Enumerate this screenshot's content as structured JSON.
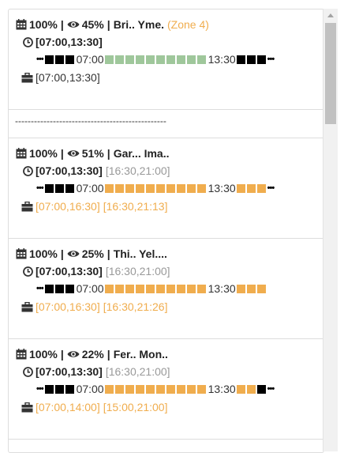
{
  "cards": [
    {
      "pct1": "100%",
      "pct2": "45%",
      "name": "Bri.. Yme.",
      "zone": "(Zone 4)",
      "hours_bold": "[07:00,13:30]",
      "hours_extra": "",
      "start_time": "07:00",
      "end_time": "13:30",
      "timeline_color": "green",
      "bar_count": 10,
      "after_blocks": [
        "black",
        "black",
        "black"
      ],
      "work_1": "[07:00,13:30]",
      "work_2": "",
      "work_color": "default"
    },
    {
      "pct1": "100%",
      "pct2": "51%",
      "name": "Gar... Ima..",
      "zone": "",
      "hours_bold": "[07:00,13:30]",
      "hours_extra": "[16:30,21:00]",
      "start_time": "07:00",
      "end_time": "13:30",
      "timeline_color": "orange",
      "bar_count": 10,
      "after_blocks": [
        "orange",
        "orange",
        "orange"
      ],
      "work_1": "[07:00,16:30]",
      "work_2": "[16:30,21:13]",
      "work_color": "orange"
    },
    {
      "pct1": "100%",
      "pct2": "25%",
      "name": "Thi.. Yel....",
      "zone": "",
      "hours_bold": "[07:00,13:30]",
      "hours_extra": "[16:30,21:00]",
      "start_time": "07:00",
      "end_time": "13:30",
      "timeline_color": "orange",
      "bar_count": 10,
      "after_blocks": [
        "orange",
        "orange",
        "orange"
      ],
      "work_1": "[07:00,16:30]",
      "work_2": "[16:30,21:26]",
      "work_color": "orange"
    },
    {
      "pct1": "100%",
      "pct2": "22%",
      "name": "Fer.. Mon..",
      "zone": "",
      "hours_bold": "[07:00,13:30]",
      "hours_extra": "[16:30,21:00]",
      "start_time": "07:00",
      "end_time": "13:30",
      "timeline_color": "orange",
      "bar_count": 10,
      "after_blocks": [
        "orange",
        "orange",
        "black"
      ],
      "work_1": "[07:00,14:00]",
      "work_2": "[15:00,21:00]",
      "work_color": "orange"
    }
  ],
  "separator_text": "------------------------------------------------",
  "dots": "•••",
  "pipe": "|",
  "colors": {
    "green": "#9fc79b",
    "orange": "#f0ad4e",
    "black": "#000000",
    "muted": "#999999"
  },
  "icons": [
    "calendar-icon",
    "eye-icon",
    "clock-icon",
    "briefcase-icon",
    "scroll-up-arrow-icon"
  ]
}
